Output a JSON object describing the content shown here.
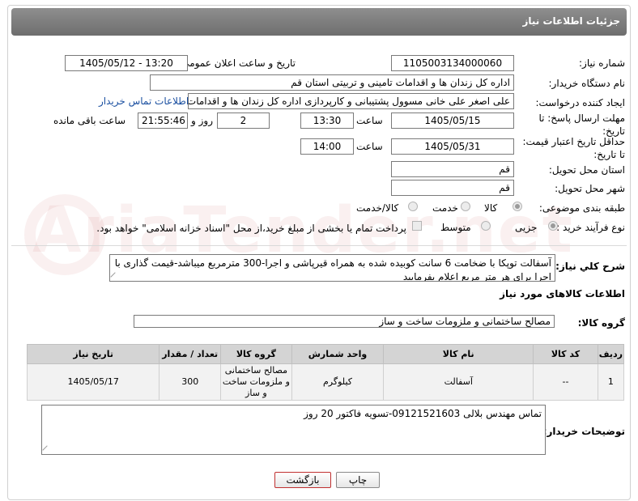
{
  "header": {
    "title": "جزئیات اطلاعات نیاز"
  },
  "watermark": {
    "text": "AriaTender.net"
  },
  "fields": {
    "need_number_label": "شماره نیاز:",
    "need_number": "1105003134000060",
    "announce_label": "تاریخ و ساعت اعلان عمومی:",
    "announce_value": "1405/05/12 - 13:20",
    "buyer_org_label": "نام دستگاه خریدار:",
    "buyer_org": "اداره کل زندان ها و اقدامات تامینی و تربیتی استان قم",
    "creator_label": "ایجاد کننده درخواست:",
    "creator": "علی اصغر علی خانی مسوول پشتیبانی و کارپردازی اداره کل زندان ها و اقدامات",
    "buyer_contact_link": "اطلاعات تماس خریدار",
    "deadline_label": "مهلت ارسال پاسخ: تا تاریخ:",
    "deadline_date": "1405/05/15",
    "time_label": "ساعت",
    "deadline_time": "13:30",
    "days_value": "2",
    "days_label": "روز و",
    "remaining_value": "21:55:46",
    "remaining_label": "ساعت باقی مانده",
    "price_validity_label": "حداقل تاریخ اعتبار قیمت: تا تاریخ:",
    "price_validity_date": "1405/05/31",
    "price_validity_time": "14:00",
    "province_label": "استان محل تحویل:",
    "province": "قم",
    "city_label": "شهر محل تحویل:",
    "city": "قم",
    "category_label": "طبقه بندی موضوعی:",
    "category_options": [
      "کالا",
      "خدمت",
      "کالا/خدمت"
    ],
    "process_label": "نوع فرآیند خرید :",
    "process_options": [
      "جزیی",
      "متوسط"
    ],
    "payment_note": "پرداخت تمام یا بخشی از مبلغ خرید،از محل \"اسناد خزانه اسلامی\" خواهد بود.",
    "summary_label": "شرح کلي نياز:",
    "summary": "آسفالت توپکا با ضخامت 6 سانت کوبیده شده به همراه قیرپاشی و اجرا-300 مترمربع میباشد-قیمت گذاری با اجرا برای هر متر مربع اعلام بفرمایید"
  },
  "goods_section": {
    "title": "اطلاعات کالاهای مورد نیاز",
    "group_label": "گروه کالا:",
    "group_value": "مصالح ساختمانی و ملزومات ساخت و ساز"
  },
  "table": {
    "headers": [
      "ردیف",
      "کد کالا",
      "نام کالا",
      "واحد شمارش",
      "گروه کالا",
      "تعداد / مقدار",
      "تاریخ نیاز"
    ],
    "rows": [
      [
        "1",
        "--",
        "آسفالت",
        "کیلوگرم",
        "مصالح ساختمانی و ملزومات ساخت و ساز",
        "300",
        "1405/05/17"
      ]
    ]
  },
  "buyer_notes": {
    "label": "توضیحات خریدار:",
    "text": "تماس مهندس بلالی 09121521603-تسویه فاکتور 20 روز"
  },
  "buttons": {
    "print": "چاپ",
    "back": "بازگشت"
  },
  "colors": {
    "header_bg": "#7a7a7a",
    "link": "#1a4fa0",
    "back_button_border": "#c03030"
  }
}
